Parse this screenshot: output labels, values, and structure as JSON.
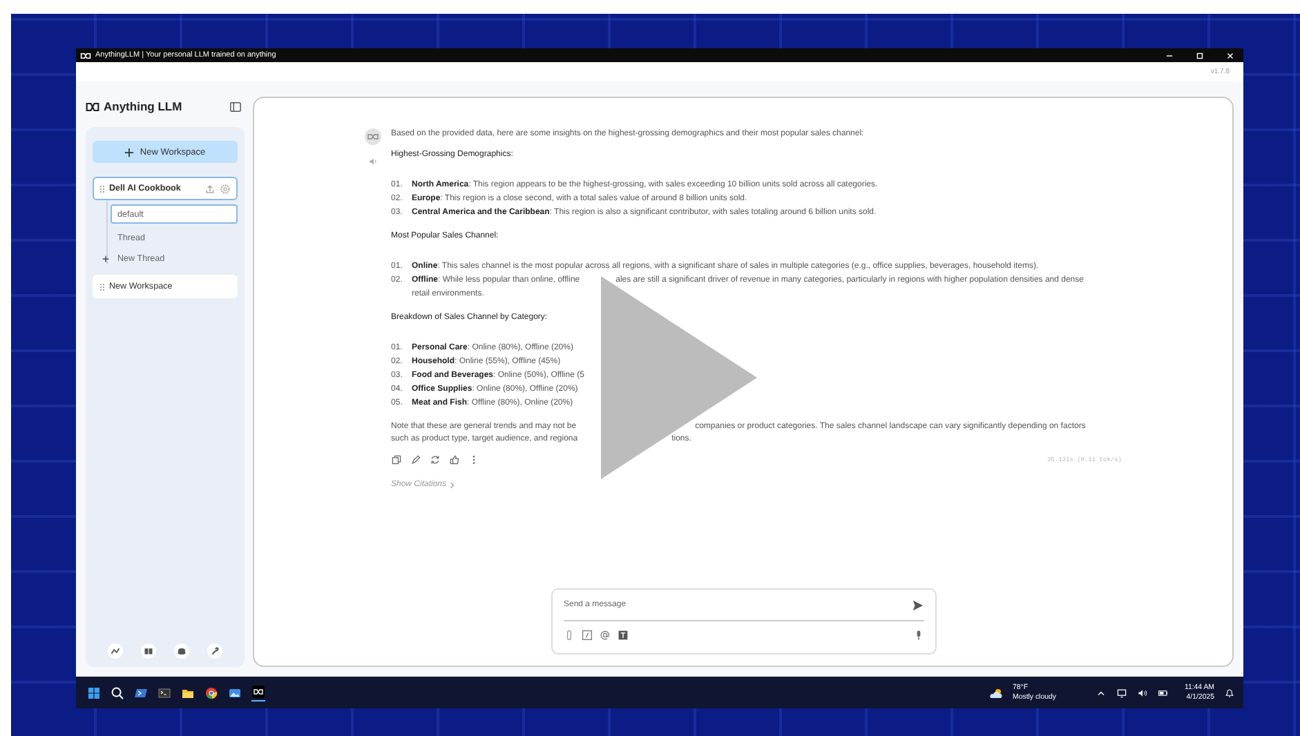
{
  "window": {
    "title": "AnythingLLM | Your personal LLM trained on anything",
    "version": "v1.7.8"
  },
  "sidebar": {
    "logo": "Anything LLM",
    "new_workspace_button": "New Workspace",
    "workspaces": [
      {
        "name": "Dell AI Cookbook",
        "selected": true,
        "threads": [
          {
            "name": "default",
            "selected": true
          },
          {
            "name": "Thread",
            "selected": false
          }
        ],
        "new_thread": "New Thread"
      },
      {
        "name": "New Workspace",
        "selected": false
      }
    ]
  },
  "chat": {
    "intro": "Based on the provided data, here are some insights on the highest-grossing demographics and their most popular sales channel:",
    "sections": [
      {
        "heading": "Highest-Grossing Demographics:",
        "items": [
          {
            "number": "01.",
            "text": "**North America**: This region appears to be the highest-grossing, with sales exceeding 10 billion units sold across all categories."
          },
          {
            "number": "02.",
            "text": "**Europe**: This region is a close second, with a total sales value of around 8 billion units sold."
          },
          {
            "number": "03.",
            "text": "**Central America and the Caribbean**: This region is also a significant contributor, with sales totaling around 6 billion units sold."
          }
        ]
      },
      {
        "heading": "Most Popular Sales Channel:",
        "items": [
          {
            "number": "01.",
            "text": "**Online**: This sales channel is the most popular across all regions, with a significant share of sales in multiple categories (e.g., office supplies, beverages, household items)."
          },
          {
            "number": "02.",
            "text": "**Offline**: While less popular than online, offline",
            "continued": "ales are still a significant driver of revenue in many categories, particularly in regions with higher population densities and dense",
            "next_line": "retail environments."
          }
        ]
      },
      {
        "heading": "Breakdown of Sales Channel by Category:",
        "items": [
          {
            "number": "01.",
            "text": "**Personal Care**: Online (80%), Offline (20%)"
          },
          {
            "number": "02.",
            "text": "**Household**: Online (55%), Offline (45%)"
          },
          {
            "number": "03.",
            "text": "**Food and Beverages**: Online (50%), Offline (5"
          },
          {
            "number": "04.",
            "text": "**Office Supplies**: Online (80%), Offline (20%)"
          },
          {
            "number": "05.",
            "text": "**Meat and Fish**: Offline (80%), Online (20%)"
          }
        ]
      }
    ],
    "note_lines": [
      {
        "left": "Note that these are general trends and may not be",
        "right": "companies or product categories. The sales channel landscape can vary significantly depending on factors"
      },
      {
        "left": "such as product type, target audience, and regiona",
        "right": "tions."
      }
    ],
    "metrics": "35.131s (9.11 tok/s)",
    "show_citations": "Show Citations"
  },
  "composer": {
    "placeholder": "Send a message"
  },
  "taskbar": {
    "temperature": "78°F",
    "weather": "Mostly cloudy",
    "time": "11:44 AM",
    "date": "4/1/2025"
  }
}
